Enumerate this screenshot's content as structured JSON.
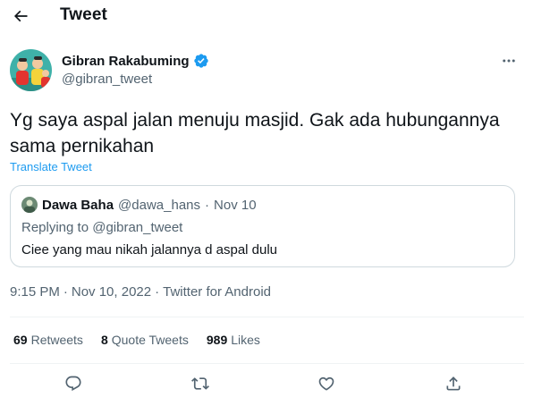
{
  "header": {
    "title": "Tweet",
    "back_icon": "arrow-left-icon"
  },
  "author": {
    "name": "Gibran Rakabuming",
    "handle": "@gibran_tweet",
    "verified_icon": "verified-badge-icon",
    "verified_color": "#1d9bf0",
    "more_icon": "more-horizontal-icon"
  },
  "tweet": {
    "text": "Yg saya aspal jalan menuju masjid. Gak ada hubungannya sama pernikahan",
    "translate_label": "Translate Tweet"
  },
  "quote": {
    "name": "Dawa Baha",
    "handle": "@dawa_hans",
    "separator": "·",
    "date": "Nov 10",
    "replying_to": "Replying to @gibran_tweet",
    "text": "Ciee yang mau nikah jalannya d aspal dulu"
  },
  "meta": {
    "time": "9:15 PM",
    "separator": "·",
    "date": "Nov 10, 2022",
    "source": "Twitter for Android"
  },
  "stats": {
    "retweets_count": "69",
    "retweets_label": "Retweets",
    "quotes_count": "8",
    "quotes_label": "Quote Tweets",
    "likes_count": "989",
    "likes_label": "Likes"
  },
  "actions": {
    "reply_icon": "reply-icon",
    "retweet_icon": "retweet-icon",
    "like_icon": "heart-icon",
    "share_icon": "share-icon"
  },
  "colors": {
    "text_primary": "#0f1419",
    "text_secondary": "#536471",
    "accent": "#1d9bf0",
    "border": "#cfd9de",
    "divider": "#eff3f4"
  }
}
